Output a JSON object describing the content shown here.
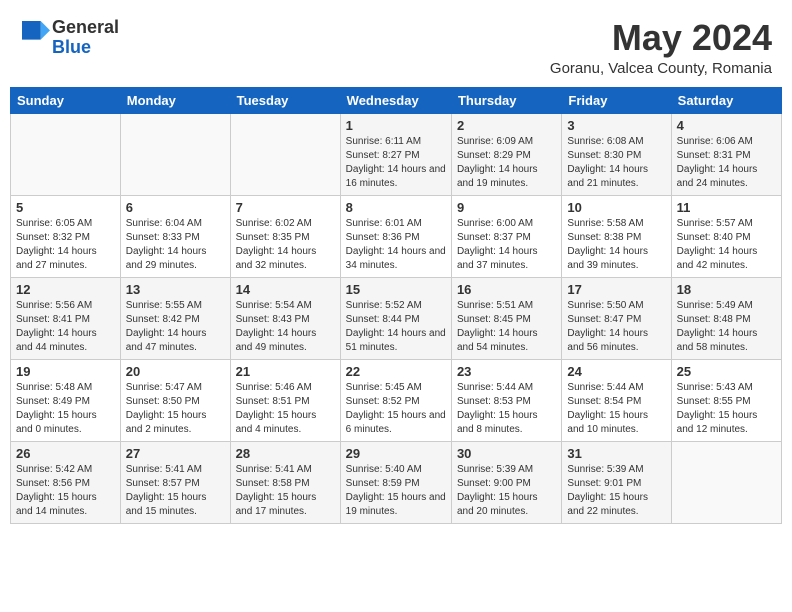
{
  "header": {
    "logo_general": "General",
    "logo_blue": "Blue",
    "month_title": "May 2024",
    "location": "Goranu, Valcea County, Romania"
  },
  "weekdays": [
    "Sunday",
    "Monday",
    "Tuesday",
    "Wednesday",
    "Thursday",
    "Friday",
    "Saturday"
  ],
  "weeks": [
    [
      {
        "day": "",
        "info": ""
      },
      {
        "day": "",
        "info": ""
      },
      {
        "day": "",
        "info": ""
      },
      {
        "day": "1",
        "info": "Sunrise: 6:11 AM\nSunset: 8:27 PM\nDaylight: 14 hours and 16 minutes."
      },
      {
        "day": "2",
        "info": "Sunrise: 6:09 AM\nSunset: 8:29 PM\nDaylight: 14 hours and 19 minutes."
      },
      {
        "day": "3",
        "info": "Sunrise: 6:08 AM\nSunset: 8:30 PM\nDaylight: 14 hours and 21 minutes."
      },
      {
        "day": "4",
        "info": "Sunrise: 6:06 AM\nSunset: 8:31 PM\nDaylight: 14 hours and 24 minutes."
      }
    ],
    [
      {
        "day": "5",
        "info": "Sunrise: 6:05 AM\nSunset: 8:32 PM\nDaylight: 14 hours and 27 minutes."
      },
      {
        "day": "6",
        "info": "Sunrise: 6:04 AM\nSunset: 8:33 PM\nDaylight: 14 hours and 29 minutes."
      },
      {
        "day": "7",
        "info": "Sunrise: 6:02 AM\nSunset: 8:35 PM\nDaylight: 14 hours and 32 minutes."
      },
      {
        "day": "8",
        "info": "Sunrise: 6:01 AM\nSunset: 8:36 PM\nDaylight: 14 hours and 34 minutes."
      },
      {
        "day": "9",
        "info": "Sunrise: 6:00 AM\nSunset: 8:37 PM\nDaylight: 14 hours and 37 minutes."
      },
      {
        "day": "10",
        "info": "Sunrise: 5:58 AM\nSunset: 8:38 PM\nDaylight: 14 hours and 39 minutes."
      },
      {
        "day": "11",
        "info": "Sunrise: 5:57 AM\nSunset: 8:40 PM\nDaylight: 14 hours and 42 minutes."
      }
    ],
    [
      {
        "day": "12",
        "info": "Sunrise: 5:56 AM\nSunset: 8:41 PM\nDaylight: 14 hours and 44 minutes."
      },
      {
        "day": "13",
        "info": "Sunrise: 5:55 AM\nSunset: 8:42 PM\nDaylight: 14 hours and 47 minutes."
      },
      {
        "day": "14",
        "info": "Sunrise: 5:54 AM\nSunset: 8:43 PM\nDaylight: 14 hours and 49 minutes."
      },
      {
        "day": "15",
        "info": "Sunrise: 5:52 AM\nSunset: 8:44 PM\nDaylight: 14 hours and 51 minutes."
      },
      {
        "day": "16",
        "info": "Sunrise: 5:51 AM\nSunset: 8:45 PM\nDaylight: 14 hours and 54 minutes."
      },
      {
        "day": "17",
        "info": "Sunrise: 5:50 AM\nSunset: 8:47 PM\nDaylight: 14 hours and 56 minutes."
      },
      {
        "day": "18",
        "info": "Sunrise: 5:49 AM\nSunset: 8:48 PM\nDaylight: 14 hours and 58 minutes."
      }
    ],
    [
      {
        "day": "19",
        "info": "Sunrise: 5:48 AM\nSunset: 8:49 PM\nDaylight: 15 hours and 0 minutes."
      },
      {
        "day": "20",
        "info": "Sunrise: 5:47 AM\nSunset: 8:50 PM\nDaylight: 15 hours and 2 minutes."
      },
      {
        "day": "21",
        "info": "Sunrise: 5:46 AM\nSunset: 8:51 PM\nDaylight: 15 hours and 4 minutes."
      },
      {
        "day": "22",
        "info": "Sunrise: 5:45 AM\nSunset: 8:52 PM\nDaylight: 15 hours and 6 minutes."
      },
      {
        "day": "23",
        "info": "Sunrise: 5:44 AM\nSunset: 8:53 PM\nDaylight: 15 hours and 8 minutes."
      },
      {
        "day": "24",
        "info": "Sunrise: 5:44 AM\nSunset: 8:54 PM\nDaylight: 15 hours and 10 minutes."
      },
      {
        "day": "25",
        "info": "Sunrise: 5:43 AM\nSunset: 8:55 PM\nDaylight: 15 hours and 12 minutes."
      }
    ],
    [
      {
        "day": "26",
        "info": "Sunrise: 5:42 AM\nSunset: 8:56 PM\nDaylight: 15 hours and 14 minutes."
      },
      {
        "day": "27",
        "info": "Sunrise: 5:41 AM\nSunset: 8:57 PM\nDaylight: 15 hours and 15 minutes."
      },
      {
        "day": "28",
        "info": "Sunrise: 5:41 AM\nSunset: 8:58 PM\nDaylight: 15 hours and 17 minutes."
      },
      {
        "day": "29",
        "info": "Sunrise: 5:40 AM\nSunset: 8:59 PM\nDaylight: 15 hours and 19 minutes."
      },
      {
        "day": "30",
        "info": "Sunrise: 5:39 AM\nSunset: 9:00 PM\nDaylight: 15 hours and 20 minutes."
      },
      {
        "day": "31",
        "info": "Sunrise: 5:39 AM\nSunset: 9:01 PM\nDaylight: 15 hours and 22 minutes."
      },
      {
        "day": "",
        "info": ""
      }
    ]
  ]
}
